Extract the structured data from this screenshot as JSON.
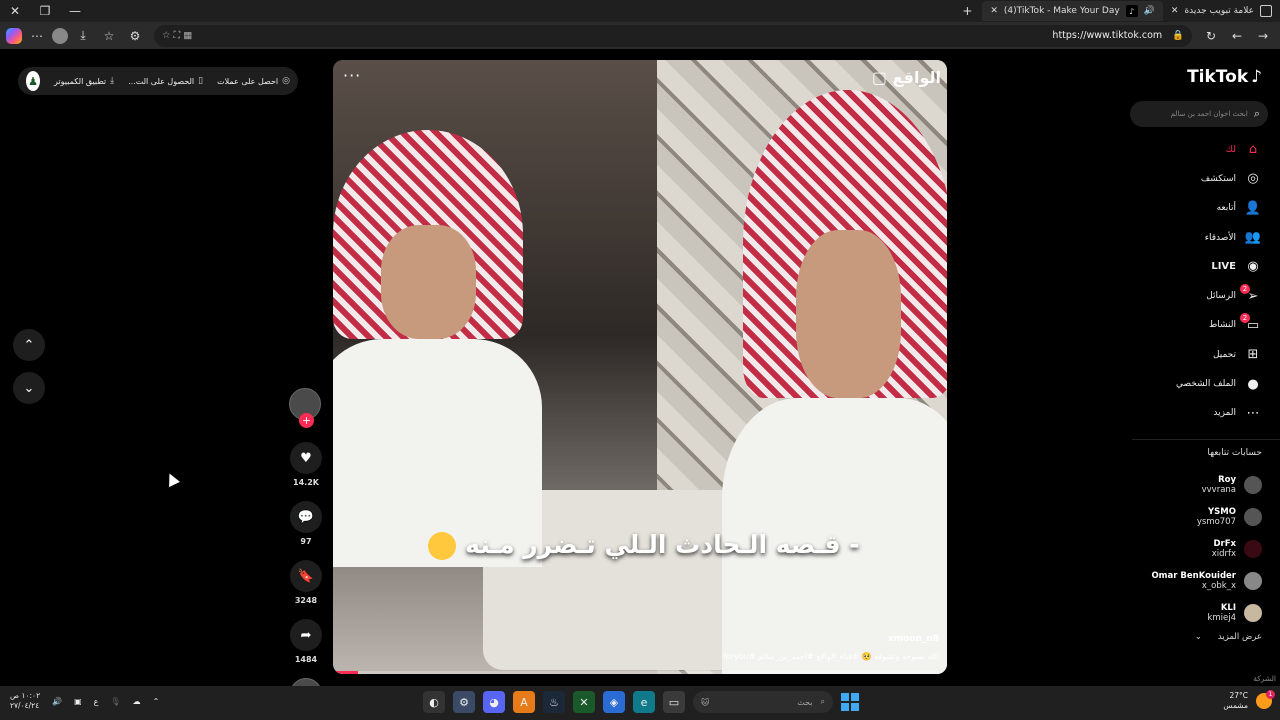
{
  "browser": {
    "tab_active_title": "(4)TikTok - Make Your Day",
    "tab_new_title": "علامة تبويب جديدة",
    "url": "https://www.tiktok.com"
  },
  "get_app": {
    "desktop": "تطبيق الكمبيوتر",
    "mobile": "الحصول على الت...",
    "coins": "احصل على عملات"
  },
  "video": {
    "watermark": "الواقع",
    "caption": "- قـصه الـحادث الـلي تـضرر مـنه",
    "author": "xmoon_n8",
    "description": "الله يسوحه ونشوفه 🥺 #قناة_الواقع #احمد_بن_سالم #foryou",
    "progress": 0.04
  },
  "actions": {
    "likes": "14.2K",
    "comments": "97",
    "saves": "3248",
    "shares": "1484"
  },
  "sidebar": {
    "logo": "TikTok",
    "search_placeholder": "ابحث اخوان احمد بن سالم",
    "menu": [
      {
        "label": "لك",
        "icon": "home-icon",
        "active": true
      },
      {
        "label": "استكشف",
        "icon": "compass-icon"
      },
      {
        "label": "أتابعه",
        "icon": "following-icon"
      },
      {
        "label": "الأصدقاء",
        "icon": "friends-icon"
      },
      {
        "label": "LIVE",
        "icon": "live-icon"
      },
      {
        "label": "الرسائل",
        "icon": "messages-icon",
        "badge": "2"
      },
      {
        "label": "النشاط",
        "icon": "activity-icon",
        "badge": "2"
      },
      {
        "label": "تحميل",
        "icon": "upload-icon"
      },
      {
        "label": "الملف الشخصي",
        "icon": "profile-icon"
      },
      {
        "label": "المزيد",
        "icon": "more-icon"
      }
    ],
    "following_title": "حسابات تتابعها",
    "following": [
      {
        "name": "Roy",
        "id": "vvvrana"
      },
      {
        "name": "YSMO",
        "id": "ysmo707"
      },
      {
        "name": "DrFx",
        "id": "xidrfx"
      },
      {
        "name": "Omar BenKouider",
        "id": "x_obk_x"
      },
      {
        "name": "KLI",
        "id": "kmiej4"
      }
    ],
    "see_more": "عرض المزيد",
    "company": "الشركة"
  },
  "taskbar": {
    "time": "١٠:٠٢ ص",
    "date": "٢٧/٠٤/٢٤",
    "lang": "ع",
    "search_placeholder": "بحث",
    "temp": "27°C",
    "weather": "مشمس",
    "weather_badge": "1"
  }
}
